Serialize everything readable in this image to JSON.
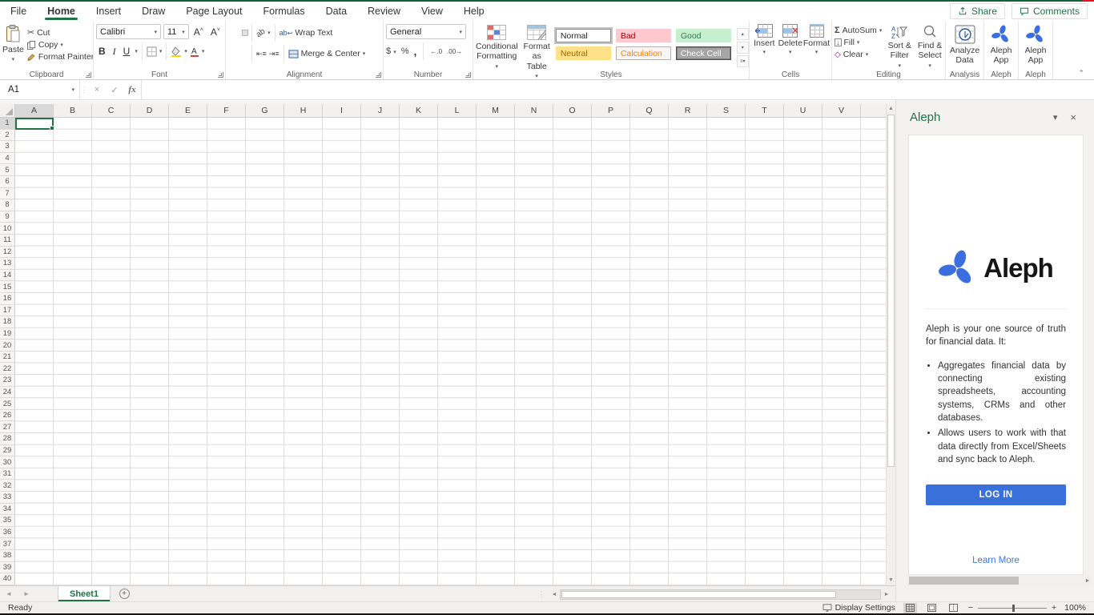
{
  "menu": {
    "tabs": [
      {
        "label": "File",
        "active": false
      },
      {
        "label": "Home",
        "active": true
      },
      {
        "label": "Insert",
        "active": false
      },
      {
        "label": "Draw",
        "active": false
      },
      {
        "label": "Page Layout",
        "active": false
      },
      {
        "label": "Formulas",
        "active": false
      },
      {
        "label": "Data",
        "active": false
      },
      {
        "label": "Review",
        "active": false
      },
      {
        "label": "View",
        "active": false
      },
      {
        "label": "Help",
        "active": false
      }
    ],
    "share_label": "Share",
    "comments_label": "Comments"
  },
  "ribbon": {
    "clipboard": {
      "group_label": "Clipboard",
      "paste": "Paste",
      "cut": "Cut",
      "copy": "Copy",
      "format_painter": "Format Painter"
    },
    "font": {
      "group_label": "Font",
      "font_name": "Calibri",
      "font_size": "11",
      "bold": "B",
      "italic": "I",
      "underline": "U",
      "grow": "A",
      "shrink": "A"
    },
    "alignment": {
      "group_label": "Alignment",
      "wrap_text": "Wrap Text",
      "merge_center": "Merge & Center",
      "orientation_glyph": "ab"
    },
    "number": {
      "group_label": "Number",
      "format": "General",
      "currency": "$",
      "percent": "%",
      "comma": ",",
      "inc_dec": "←.0",
      "dec_dec": ".00→"
    },
    "styles": {
      "group_label": "Styles",
      "conditional_formatting": "Conditional Formatting",
      "format_as_table": "Format as Table",
      "cells": [
        {
          "key": "normal",
          "label": "Normal",
          "bg": "#ffffff",
          "fg": "#1f1f1f"
        },
        {
          "key": "bad",
          "label": "Bad",
          "bg": "#ffc7ce",
          "fg": "#9c0006"
        },
        {
          "key": "good",
          "label": "Good",
          "bg": "#c6efce",
          "fg": "#357a4e"
        },
        {
          "key": "neutral",
          "label": "Neutral",
          "bg": "#ffe189",
          "fg": "#9c6500"
        },
        {
          "key": "calculation",
          "label": "Calculation",
          "bg": "#f6f5f4",
          "fg": "#fa7d00"
        },
        {
          "key": "checkcell",
          "label": "Check Cell",
          "bg": "#a5a5a5",
          "fg": "#ffffff"
        }
      ]
    },
    "cells": {
      "group_label": "Cells",
      "insert": "Insert",
      "delete": "Delete",
      "format": "Format"
    },
    "editing": {
      "group_label": "Editing",
      "autosum": "AutoSum",
      "fill": "Fill",
      "clear": "Clear",
      "sort_filter": "Sort & Filter",
      "find_select": "Find & Select",
      "sigma": "Σ"
    },
    "analysis": {
      "group_label": "Analysis",
      "analyze_data": "Analyze Data"
    },
    "aleph1": {
      "group_label": "Aleph",
      "app": "Aleph App"
    },
    "aleph2": {
      "group_label": "Aleph",
      "app": "Aleph App"
    }
  },
  "formula_bar": {
    "name_box": "A1",
    "cancel": "×",
    "enter": "✓",
    "fx": "fx",
    "input_value": ""
  },
  "grid": {
    "columns": [
      "A",
      "B",
      "C",
      "D",
      "E",
      "F",
      "G",
      "H",
      "I",
      "J",
      "K",
      "L",
      "M",
      "N",
      "O",
      "P",
      "Q",
      "R",
      "S",
      "T",
      "U",
      "V"
    ],
    "rows": [
      1,
      2,
      3,
      4,
      5,
      6,
      7,
      8,
      9,
      10,
      11,
      12,
      13,
      14,
      15,
      16,
      17,
      18,
      19,
      20,
      21,
      22,
      23,
      24,
      25,
      26,
      27,
      28,
      29,
      30,
      31,
      32,
      33,
      34,
      35,
      36,
      37,
      38,
      39,
      40
    ],
    "selected_cell": "A1",
    "selected_column": "A",
    "selected_row": 1
  },
  "sheet_bar": {
    "tabs": [
      {
        "label": "Sheet1",
        "active": true
      }
    ],
    "add_label": "+"
  },
  "status_bar": {
    "mode": "Ready",
    "display_settings": "Display Settings",
    "zoom": "100%",
    "zoom_out": "−",
    "zoom_in": "+"
  },
  "task_pane": {
    "title": "Aleph",
    "logo_text": "Aleph",
    "intro": "Aleph is your one source of truth for financial data. It:",
    "bullets": [
      "Aggregates financial data by connecting existing spreadsheets, accounting systems, CRMs and other databases.",
      "Allows users to work with that data directly from Excel/Sheets and sync back to Aleph."
    ],
    "login_label": "LOG IN",
    "learn_more_label": "Learn More"
  },
  "colors": {
    "excel_green": "#217346",
    "aleph_blue": "#3b6ee0",
    "login_blue": "#3a70d9",
    "link_blue": "#3b78db"
  }
}
